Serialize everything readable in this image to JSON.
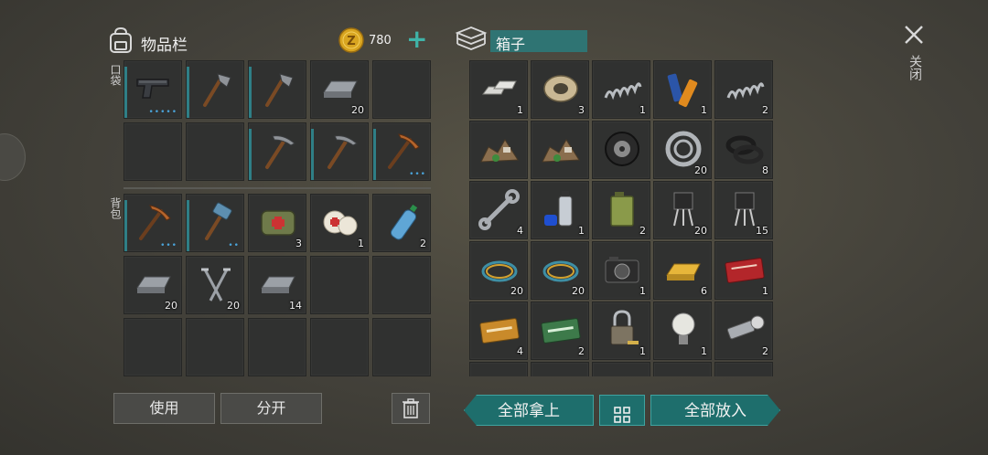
{
  "inventory": {
    "title": "物品栏",
    "currency": "780",
    "pocket_label": "口袋",
    "backpack_label": "背包",
    "pocket_slots": [
      {
        "item": "pistol",
        "count": "",
        "durability": true,
        "dots": "•••••"
      },
      {
        "item": "hatchet",
        "count": "",
        "durability": true,
        "dots": ""
      },
      {
        "item": "hatchet",
        "count": "",
        "durability": true,
        "dots": ""
      },
      {
        "item": "iron-bar",
        "count": "20",
        "durability": false,
        "dots": ""
      },
      {
        "item": "empty",
        "count": "",
        "durability": false,
        "dots": ""
      },
      {
        "item": "empty",
        "count": "",
        "durability": false,
        "dots": ""
      },
      {
        "item": "empty",
        "count": "",
        "durability": false,
        "dots": ""
      },
      {
        "item": "pickaxe",
        "count": "",
        "durability": true,
        "dots": ""
      },
      {
        "item": "pickaxe",
        "count": "",
        "durability": true,
        "dots": ""
      },
      {
        "item": "copper-pickaxe",
        "count": "",
        "durability": true,
        "dots": "•••"
      }
    ],
    "backpack_slots": [
      {
        "item": "copper-pickaxe",
        "count": "",
        "durability": true,
        "dots": "•••"
      },
      {
        "item": "hammer",
        "count": "",
        "durability": true,
        "dots": "••"
      },
      {
        "item": "medkit-bag",
        "count": "3",
        "durability": false,
        "dots": ""
      },
      {
        "item": "bandage",
        "count": "1",
        "durability": false,
        "dots": ""
      },
      {
        "item": "water-bottle",
        "count": "2",
        "durability": false,
        "dots": ""
      },
      {
        "item": "iron-bar",
        "count": "20",
        "durability": false,
        "dots": ""
      },
      {
        "item": "nails",
        "count": "20",
        "durability": false,
        "dots": ""
      },
      {
        "item": "iron-bar",
        "count": "14",
        "durability": false,
        "dots": ""
      },
      {
        "item": "empty",
        "count": "",
        "durability": false,
        "dots": ""
      },
      {
        "item": "empty",
        "count": "",
        "durability": false,
        "dots": ""
      },
      {
        "item": "empty",
        "count": "",
        "durability": false,
        "dots": ""
      },
      {
        "item": "empty",
        "count": "",
        "durability": false,
        "dots": ""
      },
      {
        "item": "empty",
        "count": "",
        "durability": false,
        "dots": ""
      },
      {
        "item": "empty",
        "count": "",
        "durability": false,
        "dots": ""
      },
      {
        "item": "empty",
        "count": "",
        "durability": false,
        "dots": ""
      }
    ],
    "use_label": "使用",
    "split_label": "分开"
  },
  "box": {
    "title": "箱子",
    "slots": [
      {
        "item": "metal-ingots",
        "count": "1"
      },
      {
        "item": "wire-spool",
        "count": "3"
      },
      {
        "item": "spring",
        "count": "1"
      },
      {
        "item": "batteries",
        "count": "1"
      },
      {
        "item": "spring",
        "count": "2"
      },
      {
        "item": "rubble-pile",
        "count": ""
      },
      {
        "item": "rubble-pile",
        "count": ""
      },
      {
        "item": "tire",
        "count": ""
      },
      {
        "item": "bearing",
        "count": "20"
      },
      {
        "item": "gaskets",
        "count": "8"
      },
      {
        "item": "wrench",
        "count": "4"
      },
      {
        "item": "spray-can",
        "count": "1"
      },
      {
        "item": "jerrycan",
        "count": "2"
      },
      {
        "item": "transistor",
        "count": "20"
      },
      {
        "item": "transistor",
        "count": "15"
      },
      {
        "item": "cable-coil",
        "count": "20"
      },
      {
        "item": "cable-coil",
        "count": "20"
      },
      {
        "item": "camera",
        "count": "1"
      },
      {
        "item": "gold-bar",
        "count": "6"
      },
      {
        "item": "combat-coupon",
        "count": "1"
      },
      {
        "item": "ammo-coupon",
        "count": "4"
      },
      {
        "item": "ration-coupon",
        "count": "2"
      },
      {
        "item": "padlock",
        "count": "1"
      },
      {
        "item": "light-bulb",
        "count": "1"
      },
      {
        "item": "flashlight",
        "count": "2"
      }
    ],
    "take_all_label": "全部拿上",
    "put_all_label": "全部放入"
  },
  "close_label": "关闭",
  "colors": {
    "teal": "#1e6e6c",
    "accent": "#2f8f8c",
    "gold": "#d9a520"
  }
}
